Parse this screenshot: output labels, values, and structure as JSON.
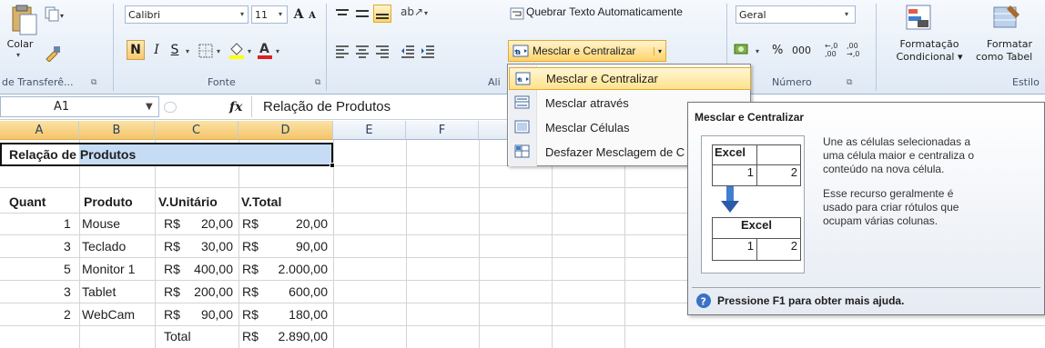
{
  "ribbon": {
    "paste_label": "Colar",
    "clipboard_group": "de Transferê...",
    "font_name": "Calibri",
    "font_size": "11",
    "bold": "N",
    "italic": "I",
    "underline": "S",
    "font_group": "Fonte",
    "align_group_cut": "Ali",
    "wrap_text": "Quebrar Texto Automaticamente",
    "merge_center": "Mesclar e Centralizar",
    "number_format": "Geral",
    "percent": "%",
    "thousands": "000",
    "number_group": "Número",
    "cond_format_1": "Formatação",
    "cond_format_2": "Condicional",
    "format_table_1": "Formatar",
    "format_table_2": "como Tabel",
    "style_group": "Estilo",
    "grow_font": "A",
    "shrink_font": "A"
  },
  "formula_bar": {
    "name_box": "A1",
    "fx": "fx",
    "content": "Relação de Produtos"
  },
  "columns": [
    "A",
    "B",
    "C",
    "D",
    "E",
    "F"
  ],
  "sheet": {
    "title": "Relação de Produtos",
    "headers": [
      "Quant",
      "Produto",
      "V.Unitário",
      "V.Total"
    ],
    "rows": [
      {
        "quant": "1",
        "produto": "Mouse",
        "cur1": "R$",
        "unit": "20,00",
        "cur2": "R$",
        "total": "20,00"
      },
      {
        "quant": "3",
        "produto": "Teclado",
        "cur1": "R$",
        "unit": "30,00",
        "cur2": "R$",
        "total": "90,00"
      },
      {
        "quant": "5",
        "produto": "Monitor 1",
        "cur1": "R$",
        "unit": "400,00",
        "cur2": "R$",
        "total": "2.000,00"
      },
      {
        "quant": "3",
        "produto": "Tablet",
        "cur1": "R$",
        "unit": "200,00",
        "cur2": "R$",
        "total": "600,00"
      },
      {
        "quant": "2",
        "produto": "WebCam",
        "cur1": "R$",
        "unit": "90,00",
        "cur2": "R$",
        "total": "180,00"
      }
    ],
    "total_label": "Total",
    "total_cur": "R$",
    "total_value": "2.890,00"
  },
  "menu": {
    "items": [
      {
        "label": "Mesclar e Centralizar"
      },
      {
        "label": "Mesclar através"
      },
      {
        "label": "Mesclar Células"
      },
      {
        "label": "Desfazer Mesclagem de C"
      }
    ]
  },
  "tooltip": {
    "title": "Mesclar e Centralizar",
    "text1_l1": "Une as células selecionadas a",
    "text1_l2": "uma célula maior e centraliza o",
    "text1_l3": "conteúdo na nova célula.",
    "text2_l1": "Esse recurso geralmente é",
    "text2_l2": "usado para criar rótulos que",
    "text2_l3": "ocupam várias colunas.",
    "example_word": "Excel",
    "example_1": "1",
    "example_2": "2",
    "help": "Pressione F1 para obter mais ajuda."
  },
  "colors": {
    "accent_selection": "#f4c56b",
    "merge_highlight": "#ffe28c",
    "selected_range": "#c6dcf5"
  }
}
